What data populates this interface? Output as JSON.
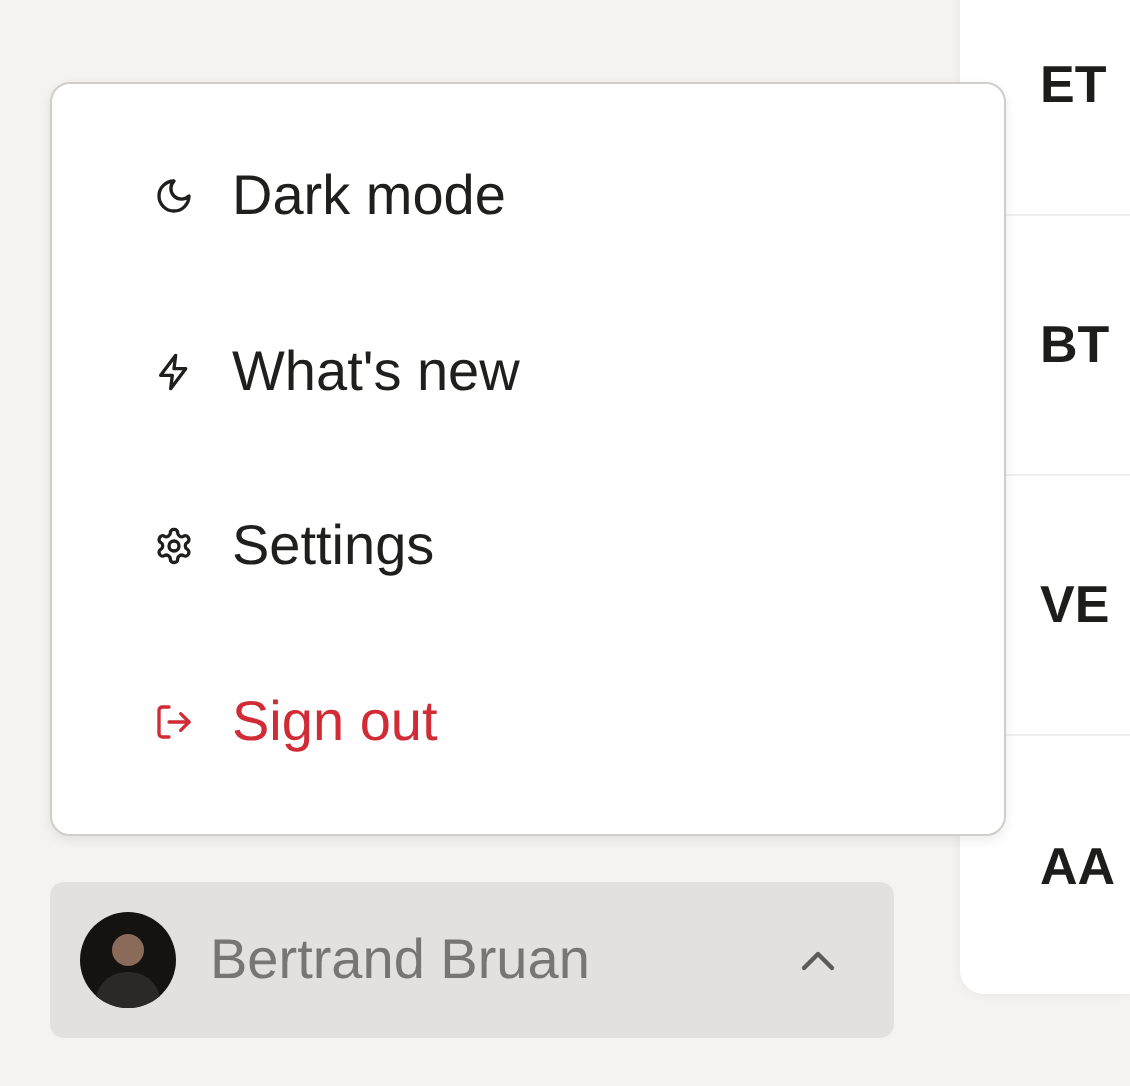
{
  "menu": {
    "items": [
      {
        "label": "Dark mode",
        "kind": "default"
      },
      {
        "label": "What's new",
        "kind": "default"
      },
      {
        "label": "Settings",
        "kind": "default"
      },
      {
        "label": "Sign out",
        "kind": "danger"
      }
    ]
  },
  "user": {
    "name": "Bertrand Bruan",
    "expanded": true
  },
  "list": {
    "rows": [
      {
        "label": "ET"
      },
      {
        "label": "BT"
      },
      {
        "label": "VE"
      },
      {
        "label": "AA"
      }
    ]
  }
}
